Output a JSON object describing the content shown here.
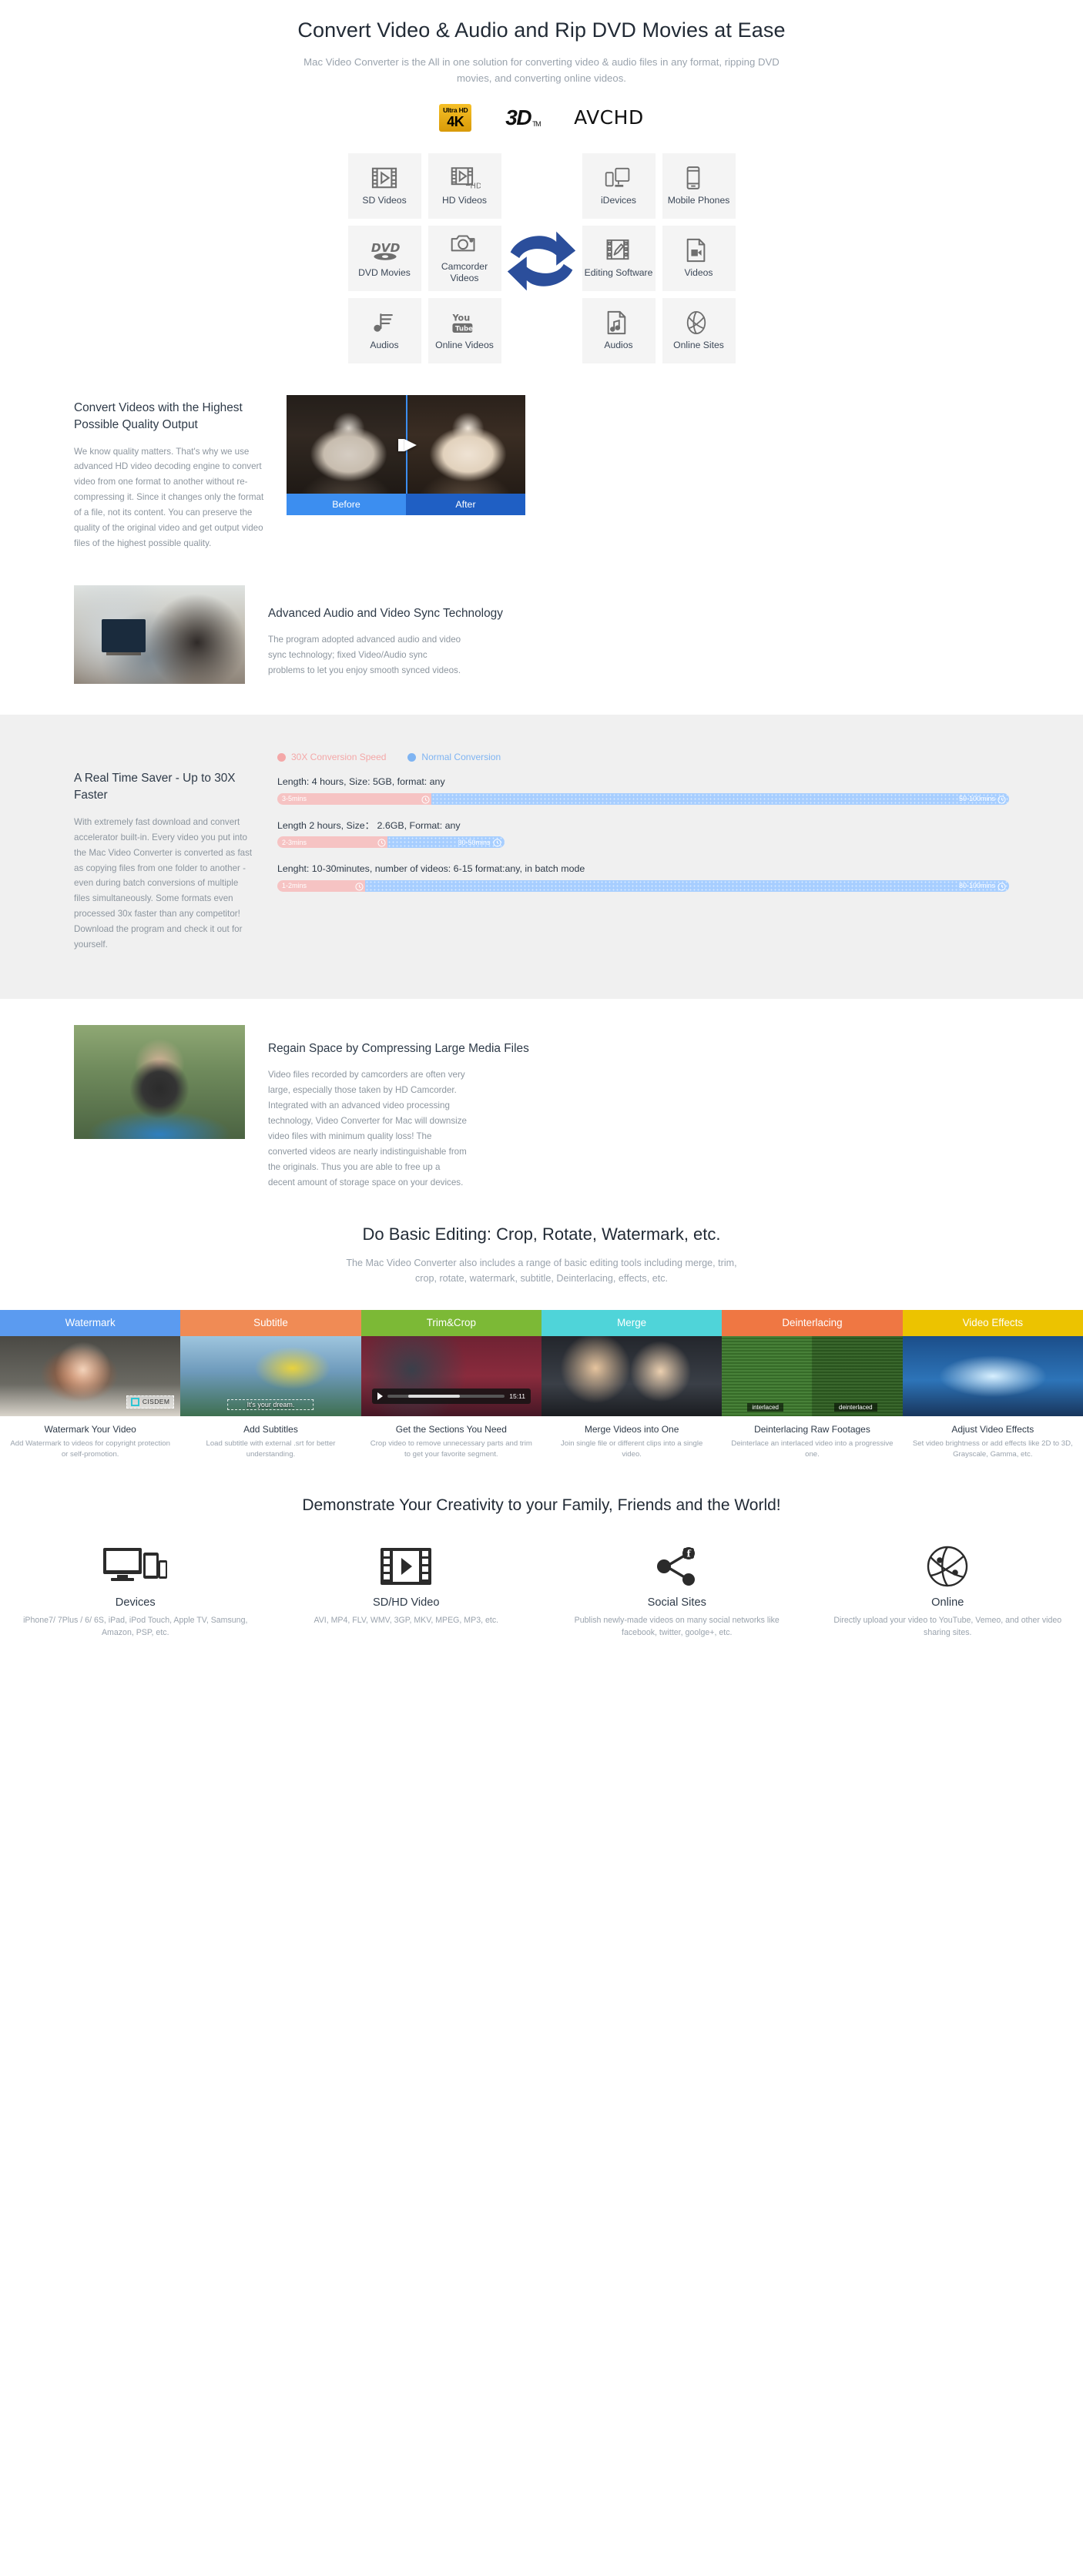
{
  "hero": {
    "title": "Convert Video & Audio and Rip DVD Movies at Ease",
    "subtitle": "Mac Video Converter is the All in one solution for converting video & audio files in any format, ripping DVD movies, and converting online videos.",
    "badges": [
      {
        "id": "badge-4k",
        "top": "Ultra HD",
        "bottom": "4K"
      },
      {
        "id": "badge-3d",
        "label": "3D",
        "sup": "TM"
      },
      {
        "id": "badge-avchd",
        "label": "AVCHD"
      }
    ]
  },
  "format_grid": {
    "input": [
      [
        "SD Videos",
        "HD Videos"
      ],
      [
        "DVD Movies",
        "Camcorder Videos"
      ],
      [
        "Audios",
        "Online Videos"
      ]
    ],
    "output": [
      [
        "iDevices",
        "Mobile Phones"
      ],
      [
        "Editing Software",
        "Videos"
      ],
      [
        "Audios",
        "Online Sites"
      ]
    ],
    "icons": {
      "sd_videos": "film-play-icon",
      "hd_videos": "film-play-hd-icon",
      "dvd_movies": "dvd-disc-icon",
      "camcorder_videos": "camera-icon",
      "audios_in": "music-note-list-icon",
      "online_videos": "youtube-icon",
      "idevices": "devices-icon",
      "mobile_phones": "phone-icon",
      "editing_software": "film-pencil-icon",
      "videos": "video-file-icon",
      "audios_out": "audio-file-icon",
      "online_sites": "globe-icon",
      "converter": "two-way-arrows-icon"
    },
    "arrow_color": "#2b4e9b"
  },
  "quality": {
    "heading": "Convert Videos with the Highest Possible Quality Output",
    "body": "We know quality matters. That's why we use advanced HD video decoding engine to convert video from one format to another without re-compressing it. Since it changes only the format of a file, not its content. You can preserve the quality of the original video and get output video files of the highest possible quality.",
    "before_label": "Before",
    "after_label": "After",
    "before_color": "#3c8ef0",
    "after_color": "#1f5fc4"
  },
  "sync": {
    "heading": "Advanced Audio and Video Sync Technology",
    "body": "The program adopted advanced audio and video sync technology; fixed Video/Audio sync problems to let you enjoy smooth synced videos."
  },
  "saver": {
    "heading": "A Real Time Saver - Up to 30X Faster",
    "body": "With extremely fast download and convert accelerator built-in. Every video you put into the Mac Video Converter is converted as fast as copying files from one folder to another - even during batch conversions of multiple files simultaneously. Some formats even processed 30x faster than any competitor! Download the program and check it out for yourself.",
    "legend": [
      {
        "label": "30X Conversion Speed",
        "color": "#f4a8a8"
      },
      {
        "label": "Normal Conversion",
        "color": "#7fb4f2"
      }
    ],
    "bars": [
      {
        "caption": "Length: 4 hours, Size: 5GB, format: any",
        "fast_label": "3-5mins",
        "normal_label": "50-100mins",
        "fast_pct": 21,
        "normal_pct": 79
      },
      {
        "caption": "Length 2 hours, Size： 2.6GB, Format: any",
        "fast_label": "2-3mins",
        "normal_label": "30-50mins",
        "fast_pct": 15,
        "normal_pct": 16
      },
      {
        "caption": "Lenght: 10-30minutes, number of videos: 6-15 format:any, in batch mode",
        "fast_label": "1-2mins",
        "normal_label": "80-100mins",
        "fast_pct": 12,
        "normal_pct": 88
      }
    ]
  },
  "compress": {
    "heading": "Regain Space by Compressing Large Media Files",
    "body": "Video files recorded by camcorders are often very large, especially those taken by HD Camcorder. Integrated with an advanced video processing technology, Video Converter for Mac will downsize video files with minimum quality loss! The converted videos are nearly indistinguishable from the originals. Thus you are able to free up a decent amount of storage space on your devices."
  },
  "editing": {
    "heading": "Do Basic Editing: Crop, Rotate, Watermark, etc.",
    "subtitle": "The Mac Video Converter also includes a range of basic editing tools including merge, trim, crop, rotate, watermark, subtitle, Deinterlacing, effects, etc.",
    "tabs": [
      {
        "label": "Watermark",
        "color": "#5b9bf0"
      },
      {
        "label": "Subtitle",
        "color": "#f08b55"
      },
      {
        "label": "Trim&Crop",
        "color": "#7cb936"
      },
      {
        "label": "Merge",
        "color": "#4fd4d9"
      },
      {
        "label": "Deinterlacing",
        "color": "#ef7743"
      },
      {
        "label": "Video Effects",
        "color": "#ecc300"
      }
    ],
    "thumb_overlays": {
      "watermark_brand": "CISDEM",
      "subtitle_text": "It's your dream.",
      "trim_time": "15:11",
      "deint_left": "interlaced",
      "deint_right": "deinterlaced"
    },
    "captions": [
      {
        "title": "Watermark Your Video",
        "text": "Add Watermark to videos for copyright protection or self-promotion."
      },
      {
        "title": "Add Subtitles",
        "text": "Load subtitle with external .srt for better understanding."
      },
      {
        "title": "Get the Sections You Need",
        "text": "Crop video to remove unnecessary parts and trim to get your favorite segment."
      },
      {
        "title": "Merge Videos into One",
        "text": "Join single file or different clips into a single video."
      },
      {
        "title": "Deinterlacing Raw Footages",
        "text": "Deinterlace an interlaced video into a progressive one."
      },
      {
        "title": "Adjust Video Effects",
        "text": "Set video brightness or add effects like 2D to 3D, Grayscale, Gamma, etc."
      }
    ]
  },
  "demonstrate": {
    "heading": "Demonstrate Your Creativity to your Family, Friends and the World!",
    "items": [
      {
        "icon": "devices-monitor-icon",
        "title": "Devices",
        "text": "iPhone7/ 7Plus / 6/ 6S, iPad, iPod Touch, Apple TV, Samsung, Amazon, PSP, etc."
      },
      {
        "icon": "film-play-icon",
        "title": "SD/HD Video",
        "text": "AVI, MP4, FLV, WMV, 3GP, MKV, MPEG, MP3, etc."
      },
      {
        "icon": "share-nodes-icon",
        "title": "Social Sites",
        "text": "Publish newly-made videos on many social networks like facebook, twitter, goolge+, etc."
      },
      {
        "icon": "globe-icon",
        "title": "Online",
        "text": "Directly upload your video to YouTube, Vemeo, and other video sharing sites."
      }
    ]
  }
}
